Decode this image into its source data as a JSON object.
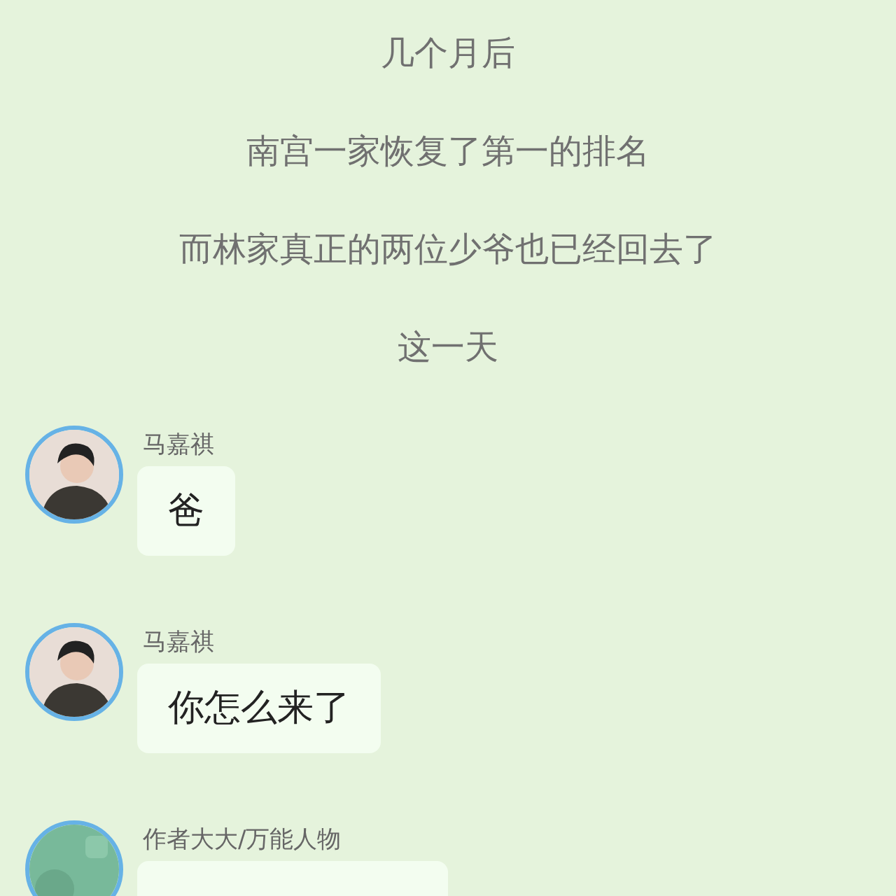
{
  "narration": [
    "几个月后",
    "南宫一家恢复了第一的排名",
    "而林家真正的两位少爷也已经回去了",
    "这一天"
  ],
  "messages": [
    {
      "sender": "马嘉祺",
      "avatar": {
        "kind": "person"
      },
      "text": "爸"
    },
    {
      "sender": "马嘉祺",
      "avatar": {
        "kind": "person"
      },
      "text": "你怎么来了"
    },
    {
      "sender": "作者大大/万能人物"
    }
  ]
}
